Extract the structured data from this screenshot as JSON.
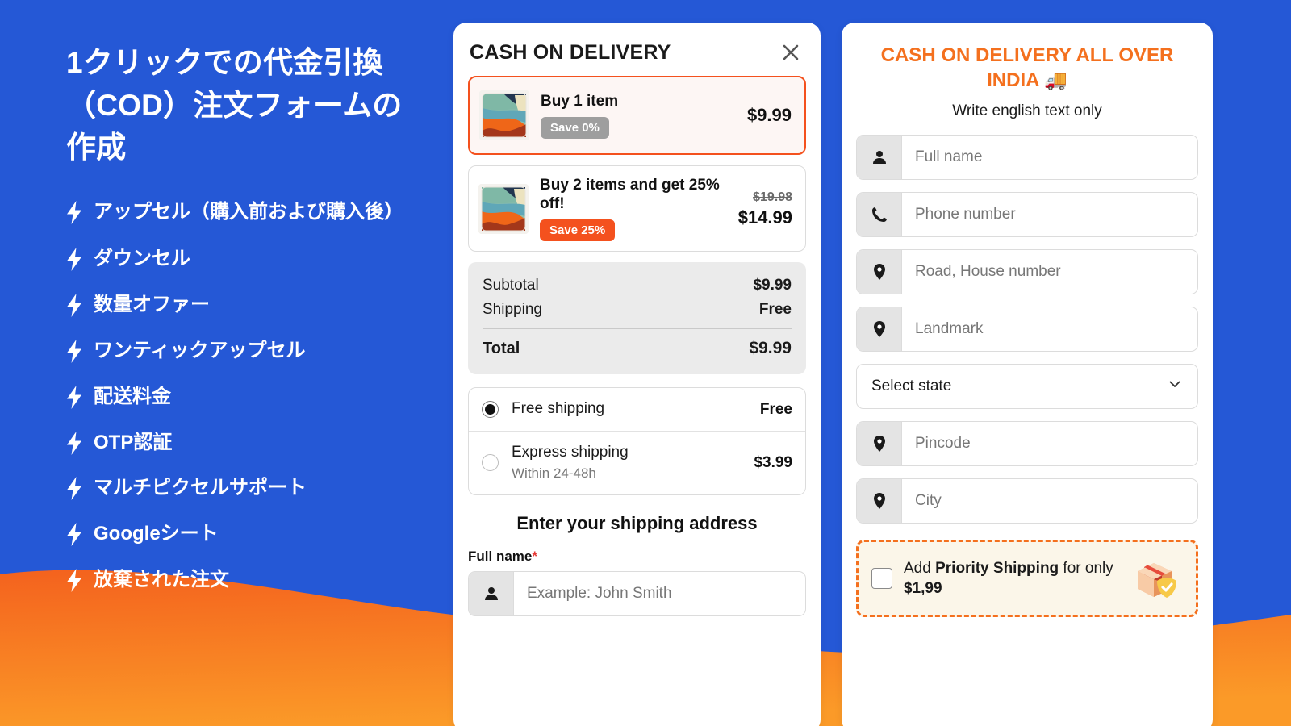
{
  "theme": {
    "blue": "#2558D6",
    "orange": "#F4701E",
    "orange_dark": "#F4511E",
    "white": "#FFFFFF"
  },
  "left_panel": {
    "headline": "1クリックでの代金引換\n（COD）注文フォームの作成",
    "features": [
      {
        "label": "アップセル（購入前および購入後）"
      },
      {
        "label": "ダウンセル"
      },
      {
        "label": "数量オファー"
      },
      {
        "label": "ワンティックアップセル"
      },
      {
        "label": "配送料金"
      },
      {
        "label": "OTP認証"
      },
      {
        "label": "マルチピクセルサポート"
      },
      {
        "label": "Googleシート"
      },
      {
        "label": "放棄された注文"
      }
    ]
  },
  "middle_card": {
    "title": "CASH ON DELIVERY",
    "close_icon": "close-icon",
    "offers": [
      {
        "title": "Buy 1 item",
        "badge": "Save 0%",
        "badge_style": "grey",
        "price_old": "",
        "price_now": "$9.99",
        "selected": true
      },
      {
        "title": "Buy 2 items and get 25% off!",
        "badge": "Save 25%",
        "badge_style": "orange",
        "price_old": "$19.98",
        "price_now": "$14.99",
        "selected": false
      }
    ],
    "totals": [
      {
        "label": "Subtotal",
        "value": "$9.99"
      },
      {
        "label": "Shipping",
        "value": "Free"
      }
    ],
    "grand_total": {
      "label": "Total",
      "value": "$9.99"
    },
    "shipping_options": [
      {
        "name": "Free shipping",
        "sub": "",
        "price": "Free",
        "selected": true
      },
      {
        "name": "Express shipping",
        "sub": "Within 24-48h",
        "price": "$3.99",
        "selected": false
      }
    ],
    "address_heading": "Enter your shipping address",
    "fullname_label": "Full name",
    "required_mark": "*",
    "fullname_placeholder": "Example: John Smith",
    "fullname_icon": "person-icon"
  },
  "right_card": {
    "title": "CASH ON DELIVERY ALL OVER INDIA",
    "title_emoji": "🚚",
    "subtitle": "Write english text only",
    "fields": [
      {
        "placeholder": "Full name",
        "icon": "person-icon",
        "name": "full-name"
      },
      {
        "placeholder": "Phone number",
        "icon": "phone-icon",
        "name": "phone-number"
      },
      {
        "placeholder": "Road, House number",
        "icon": "map-pin-icon",
        "name": "road-house-number"
      },
      {
        "placeholder": "Landmark",
        "icon": "map-pin-icon",
        "name": "landmark"
      }
    ],
    "state_select": {
      "value": "Select state",
      "icon": "chevron-down-icon"
    },
    "fields_after": [
      {
        "placeholder": "Pincode",
        "icon": "map-pin-icon",
        "name": "pincode"
      },
      {
        "placeholder": "City",
        "icon": "map-pin-icon",
        "name": "city"
      }
    ],
    "priority": {
      "text_before": "Add ",
      "text_bold": "Priority Shipping",
      "text_middle": " for only ",
      "price_bold": "$1,99",
      "icon": "package-shield-icon",
      "checked": false
    }
  }
}
